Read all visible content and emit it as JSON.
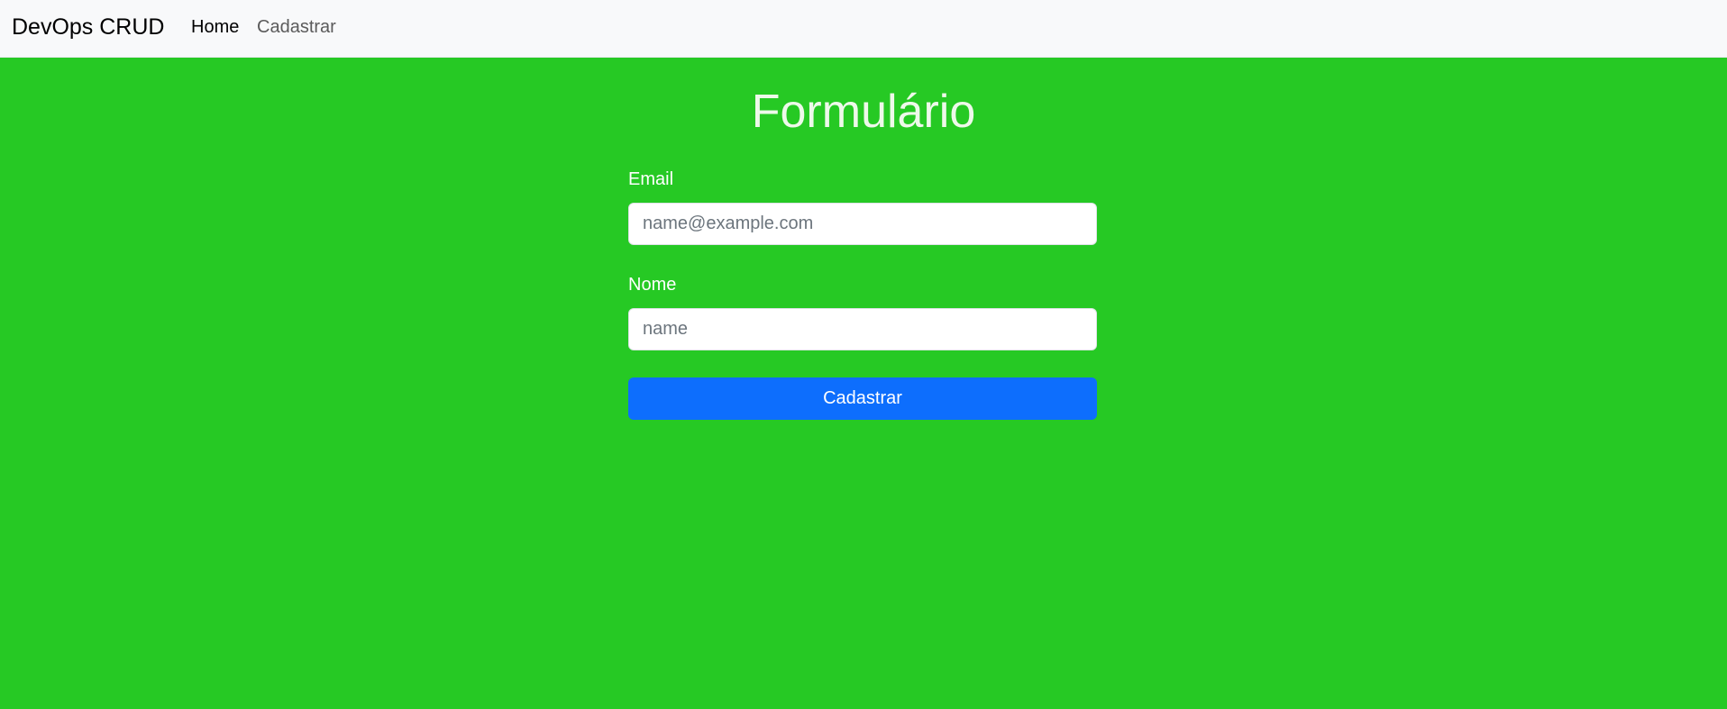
{
  "navbar": {
    "brand": "DevOps CRUD",
    "links": [
      {
        "label": "Home"
      },
      {
        "label": "Cadastrar"
      }
    ]
  },
  "form": {
    "title": "Formulário",
    "email": {
      "label": "Email",
      "value": "",
      "placeholder": "name@example.com"
    },
    "nome": {
      "label": "Nome",
      "value": "",
      "placeholder": "name"
    },
    "submit_label": "Cadastrar"
  },
  "colors": {
    "background": "#26c924",
    "navbar": "#f8f9fa",
    "primary": "#0d6efd"
  }
}
